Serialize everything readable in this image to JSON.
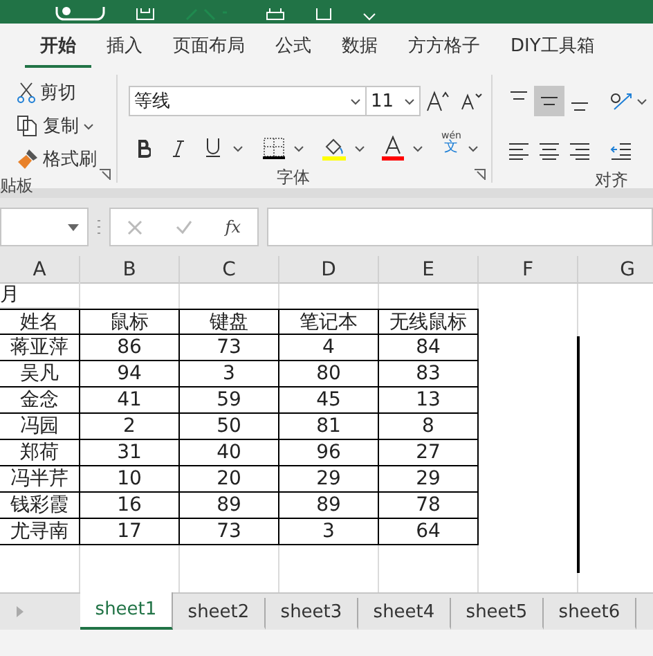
{
  "ribbon_tabs": [
    {
      "label": "开始",
      "selected": true
    },
    {
      "label": "插入",
      "selected": false
    },
    {
      "label": "页面布局",
      "selected": false
    },
    {
      "label": "公式",
      "selected": false
    },
    {
      "label": "数据",
      "selected": false
    },
    {
      "label": "方方格子",
      "selected": false
    },
    {
      "label": "DIY工具箱",
      "selected": false
    }
  ],
  "clipboard": {
    "cut": "剪切",
    "copy": "复制",
    "format_painter": "格式刷",
    "label": "贴板"
  },
  "font": {
    "name": "等线",
    "size": "11",
    "phonetic": "wén",
    "phonetic_char": "文",
    "label": "字体"
  },
  "alignment": {
    "label": "对齐",
    "vertical": [
      {
        "selected": false
      },
      {
        "selected": true
      },
      {
        "selected": false
      }
    ]
  },
  "formula_bar": {
    "fx": "fx"
  },
  "columns": [
    "A",
    "B",
    "C",
    "D",
    "E",
    "F",
    "G"
  ],
  "title_cell": "月",
  "table": {
    "header": [
      "姓名",
      "鼠标",
      "键盘",
      "笔记本",
      "无线鼠标"
    ],
    "rows": [
      [
        "蒋亚萍",
        "86",
        "73",
        "4",
        "84"
      ],
      [
        "吴凡",
        "94",
        "3",
        "80",
        "83"
      ],
      [
        "金念",
        "41",
        "59",
        "45",
        "13"
      ],
      [
        "冯园",
        "2",
        "50",
        "81",
        "8"
      ],
      [
        "郑荷",
        "31",
        "40",
        "96",
        "27"
      ],
      [
        "冯半芹",
        "10",
        "20",
        "29",
        "29"
      ],
      [
        "钱彩霞",
        "16",
        "89",
        "89",
        "78"
      ],
      [
        "尤寻南",
        "17",
        "73",
        "3",
        "64"
      ]
    ]
  },
  "sheet_tabs": [
    {
      "label": "sheet1",
      "selected": true
    },
    {
      "label": "sheet2",
      "selected": false
    },
    {
      "label": "sheet3",
      "selected": false
    },
    {
      "label": "sheet4",
      "selected": false
    },
    {
      "label": "sheet5",
      "selected": false
    },
    {
      "label": "sheet6",
      "selected": false
    }
  ]
}
